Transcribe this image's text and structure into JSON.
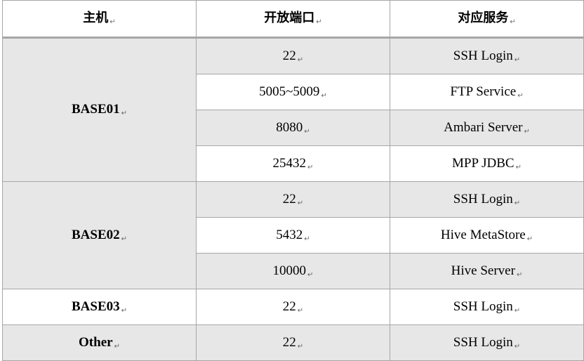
{
  "table": {
    "headers": [
      "主机",
      "开放端口",
      "对应服务"
    ],
    "paragraph_mark": "↵",
    "groups": [
      {
        "host": "BASE01",
        "rows": [
          {
            "port": "22",
            "service": "SSH Login"
          },
          {
            "port": "5005~5009",
            "service": "FTP Service"
          },
          {
            "port": "8080",
            "service": "Ambari Server"
          },
          {
            "port": "25432",
            "service": "MPP JDBC"
          }
        ]
      },
      {
        "host": "BASE02",
        "rows": [
          {
            "port": "22",
            "service": "SSH Login"
          },
          {
            "port": "5432",
            "service": "Hive MetaStore"
          },
          {
            "port": "10000",
            "service": "Hive Server"
          }
        ]
      },
      {
        "host": "BASE03",
        "rows": [
          {
            "port": "22",
            "service": "SSH Login"
          }
        ]
      },
      {
        "host": "Other",
        "rows": [
          {
            "port": "22",
            "service": "SSH Login"
          }
        ]
      }
    ]
  }
}
